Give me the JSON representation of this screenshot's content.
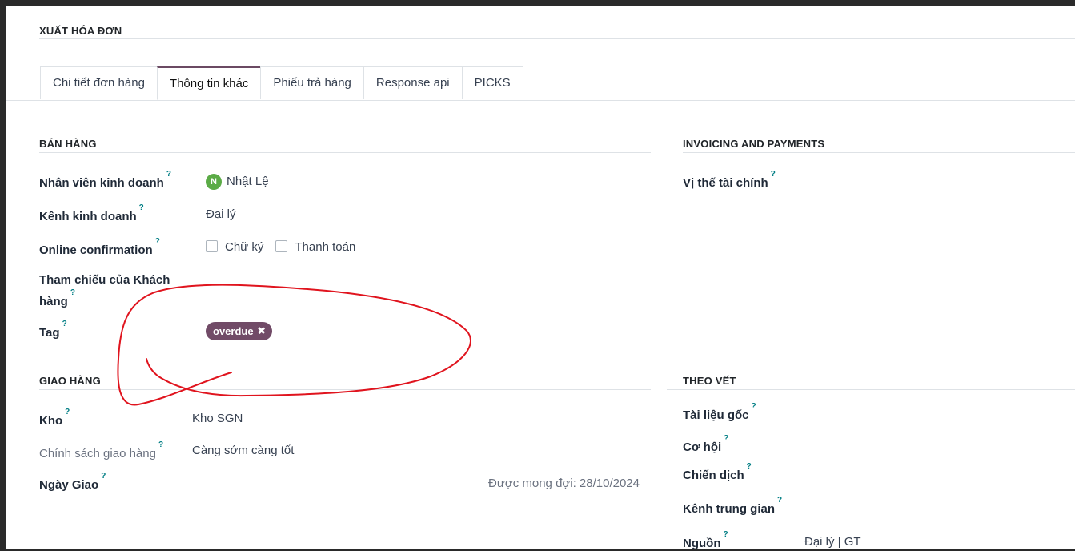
{
  "section_title": "XUẤT HÓA ĐƠN",
  "tabs": [
    {
      "label": "Chi tiết đơn hàng"
    },
    {
      "label": "Thông tin khác"
    },
    {
      "label": "Phiếu trả hàng"
    },
    {
      "label": "Response api"
    },
    {
      "label": "PICKS"
    }
  ],
  "sales": {
    "heading": "BÁN HÀNG",
    "salesperson_label": "Nhân viên kinh doanh",
    "salesperson_avatar": "N",
    "salesperson_value": "Nhật Lệ",
    "channel_label": "Kênh kinh doanh",
    "channel_value": "Đại lý",
    "online_label": "Online confirmation",
    "signature_label": "Chữ ký",
    "payment_label": "Thanh toán",
    "customer_ref_label_1": "Tham chiếu của Khách",
    "customer_ref_label_2": "hàng",
    "tag_label": "Tag",
    "tag_value": "overdue"
  },
  "invoicing": {
    "heading": "INVOICING AND PAYMENTS",
    "fiscal_label": "Vị thế tài chính"
  },
  "delivery": {
    "heading": "GIAO HÀNG",
    "warehouse_label": "Kho",
    "warehouse_value": "Kho SGN",
    "policy_label": "Chính sách giao hàng",
    "policy_value": "Càng sớm càng tốt",
    "date_label": "Ngày Giao",
    "expected_text": "Được mong đợi: 28/10/2024"
  },
  "tracking": {
    "heading": "THEO VẾT",
    "source_doc_label": "Tài liệu gốc",
    "opportunity_label": "Cơ hội",
    "campaign_label": "Chiến dịch",
    "medium_label": "Kênh trung gian",
    "source_label": "Nguồn",
    "source_value": "Đại lý | GT"
  },
  "help_mark": "?",
  "tag_remove_glyph": "✖",
  "colors": {
    "tag": "#714b67",
    "avatar": "#5bab46",
    "annotation": "#e0141e",
    "help": "#017e84"
  }
}
